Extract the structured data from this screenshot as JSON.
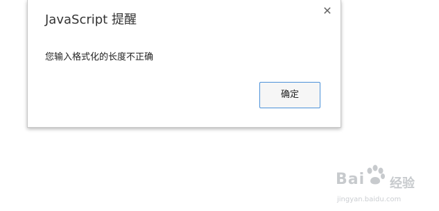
{
  "dialog": {
    "title": "JavaScript 提醒",
    "message": "您输入格式化的长度不正确",
    "ok_label": "确定",
    "close_icon": "close-icon"
  },
  "watermark": {
    "brand": "Bai",
    "brand_suffix": "经验",
    "url": "jingyan.baidu.com",
    "logo_icon": "baidu-paw-icon"
  },
  "colors": {
    "button_border": "#4a90d9",
    "dialog_border": "#c8c8c8"
  }
}
